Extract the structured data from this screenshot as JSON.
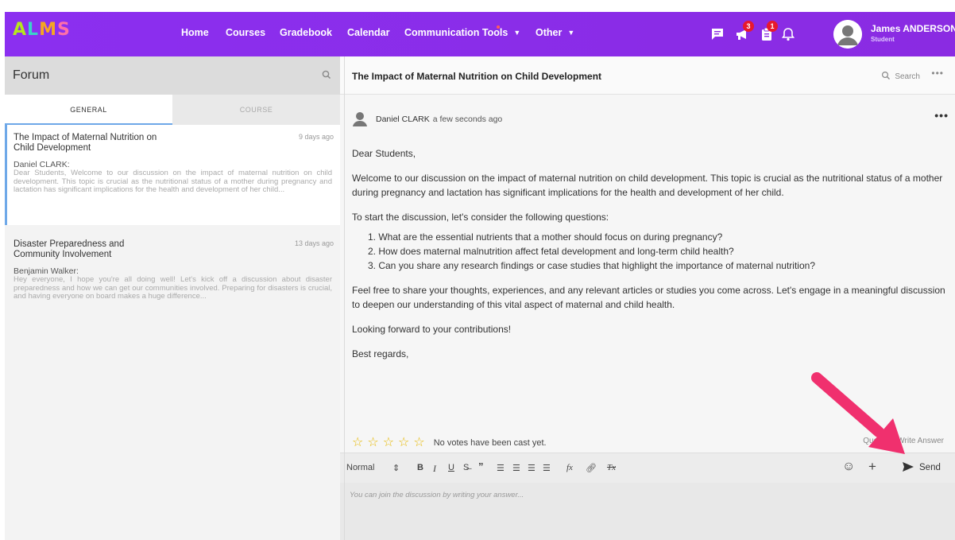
{
  "brand": {
    "logo_letters": [
      "A",
      "L",
      "M",
      "S"
    ]
  },
  "nav": {
    "links": [
      "Home",
      "Courses",
      "Gradebook",
      "Calendar",
      "Communication Tools",
      "Other"
    ],
    "badges": {
      "megaphone": "3",
      "clipboard": "1"
    }
  },
  "user": {
    "name": "James ANDERSON",
    "role": "Student"
  },
  "forum": {
    "title": "Forum",
    "tabs": [
      "GENERAL",
      "COURSE"
    ],
    "threads": [
      {
        "title": "The Impact of Maternal Nutrition on Child Development",
        "date": "9 days ago",
        "author": "Daniel CLARK:",
        "excerpt": "Dear Students, Welcome to our discussion on the impact of maternal nutrition on child development. This topic is crucial as the nutritional status of a mother during pregnancy and lactation has significant implications for the health and development of her child..."
      },
      {
        "title": "Disaster Preparedness and Community Involvement",
        "date": "13 days ago",
        "author": "Benjamin Walker:",
        "excerpt": "Hey everyone, I hope you're all doing well! Let's kick off a discussion about disaster preparedness and how we can get our communities involved. Preparing for disasters is crucial, and having everyone on board makes a huge difference..."
      }
    ]
  },
  "post": {
    "title": "The Impact of Maternal Nutrition on Child Development",
    "search_label": "Search",
    "author": "Daniel CLARK",
    "time": "a few seconds ago",
    "greeting": "Dear Students,",
    "intro": "Welcome to our discussion on the impact of maternal nutrition on child development. This topic is crucial as the nutritional status of a mother during pregnancy and lactation has significant implications for the health and development of her child.",
    "lead": "To start the discussion, let's consider the following questions:",
    "questions": [
      "1. What are the essential nutrients that a mother should focus on during pregnancy?",
      "2. How does maternal malnutrition affect fetal development and long-term child health?",
      "3. Can you share any research findings or case studies that highlight the importance of maternal nutrition?"
    ],
    "closing": "Feel free to share your thoughts, experiences, and any relevant articles or studies you come across. Let's engage in a meaningful discussion to deepen our understanding of this vital aspect of maternal and child health.",
    "looking_forward": "Looking forward to your contributions!",
    "signoff": "Best regards,",
    "rating": {
      "stars_filled": 0,
      "stars_total": 5,
      "votes_text": "No votes have been cast yet."
    },
    "actions": [
      "Quoting",
      "Write Answer"
    ]
  },
  "editor": {
    "format_select": "Normal",
    "send_label": "Send",
    "placeholder": "You can join the discussion by writing your answer..."
  },
  "colors": {
    "navbar": "#8a2be2",
    "accent_blue": "#6ea8e8",
    "star": "#e6b800",
    "annotation_arrow": "#f0306e",
    "badge": "#e8192c"
  }
}
